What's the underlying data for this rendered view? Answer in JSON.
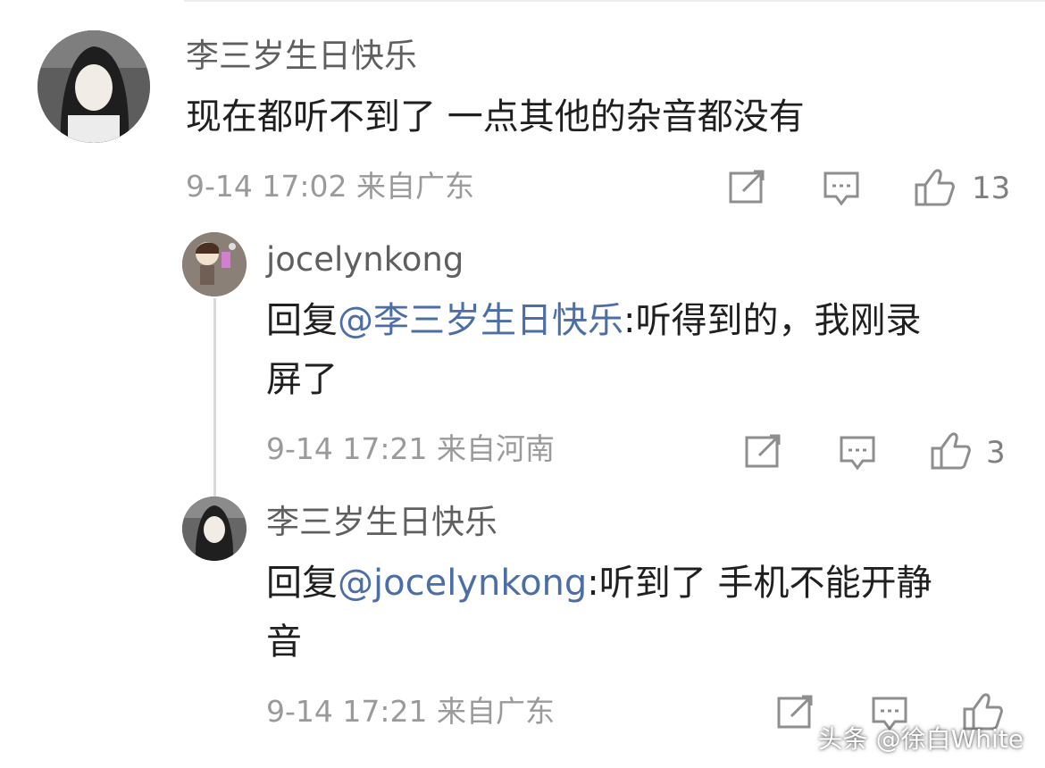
{
  "comment": {
    "username": "李三岁生日快乐",
    "text": "现在都听不到了 一点其他的杂音都没有",
    "meta": "9-14 17:02 来自广东",
    "likes": "13"
  },
  "replies": [
    {
      "username": "jocelynkong",
      "prefix": "回复",
      "mention": "@李三岁生日快乐",
      "text_line1": ":听得到的，我刚录",
      "text_line2": "屏了",
      "meta": "9-14 17:21 来自河南",
      "likes": "3"
    },
    {
      "username": "李三岁生日快乐",
      "prefix": "回复",
      "mention": "@jocelynkong",
      "text_line1": ":听到了 手机不能开静",
      "text_line2": "音",
      "meta": "9-14 17:21 来自广东"
    }
  ],
  "watermark": "头条 @徐白White",
  "icons": {
    "share": "share-icon",
    "comment": "comment-icon",
    "like": "thumb-up-icon"
  },
  "colors": {
    "mention": "#4b6ea6",
    "meta": "#9a9a9a"
  }
}
